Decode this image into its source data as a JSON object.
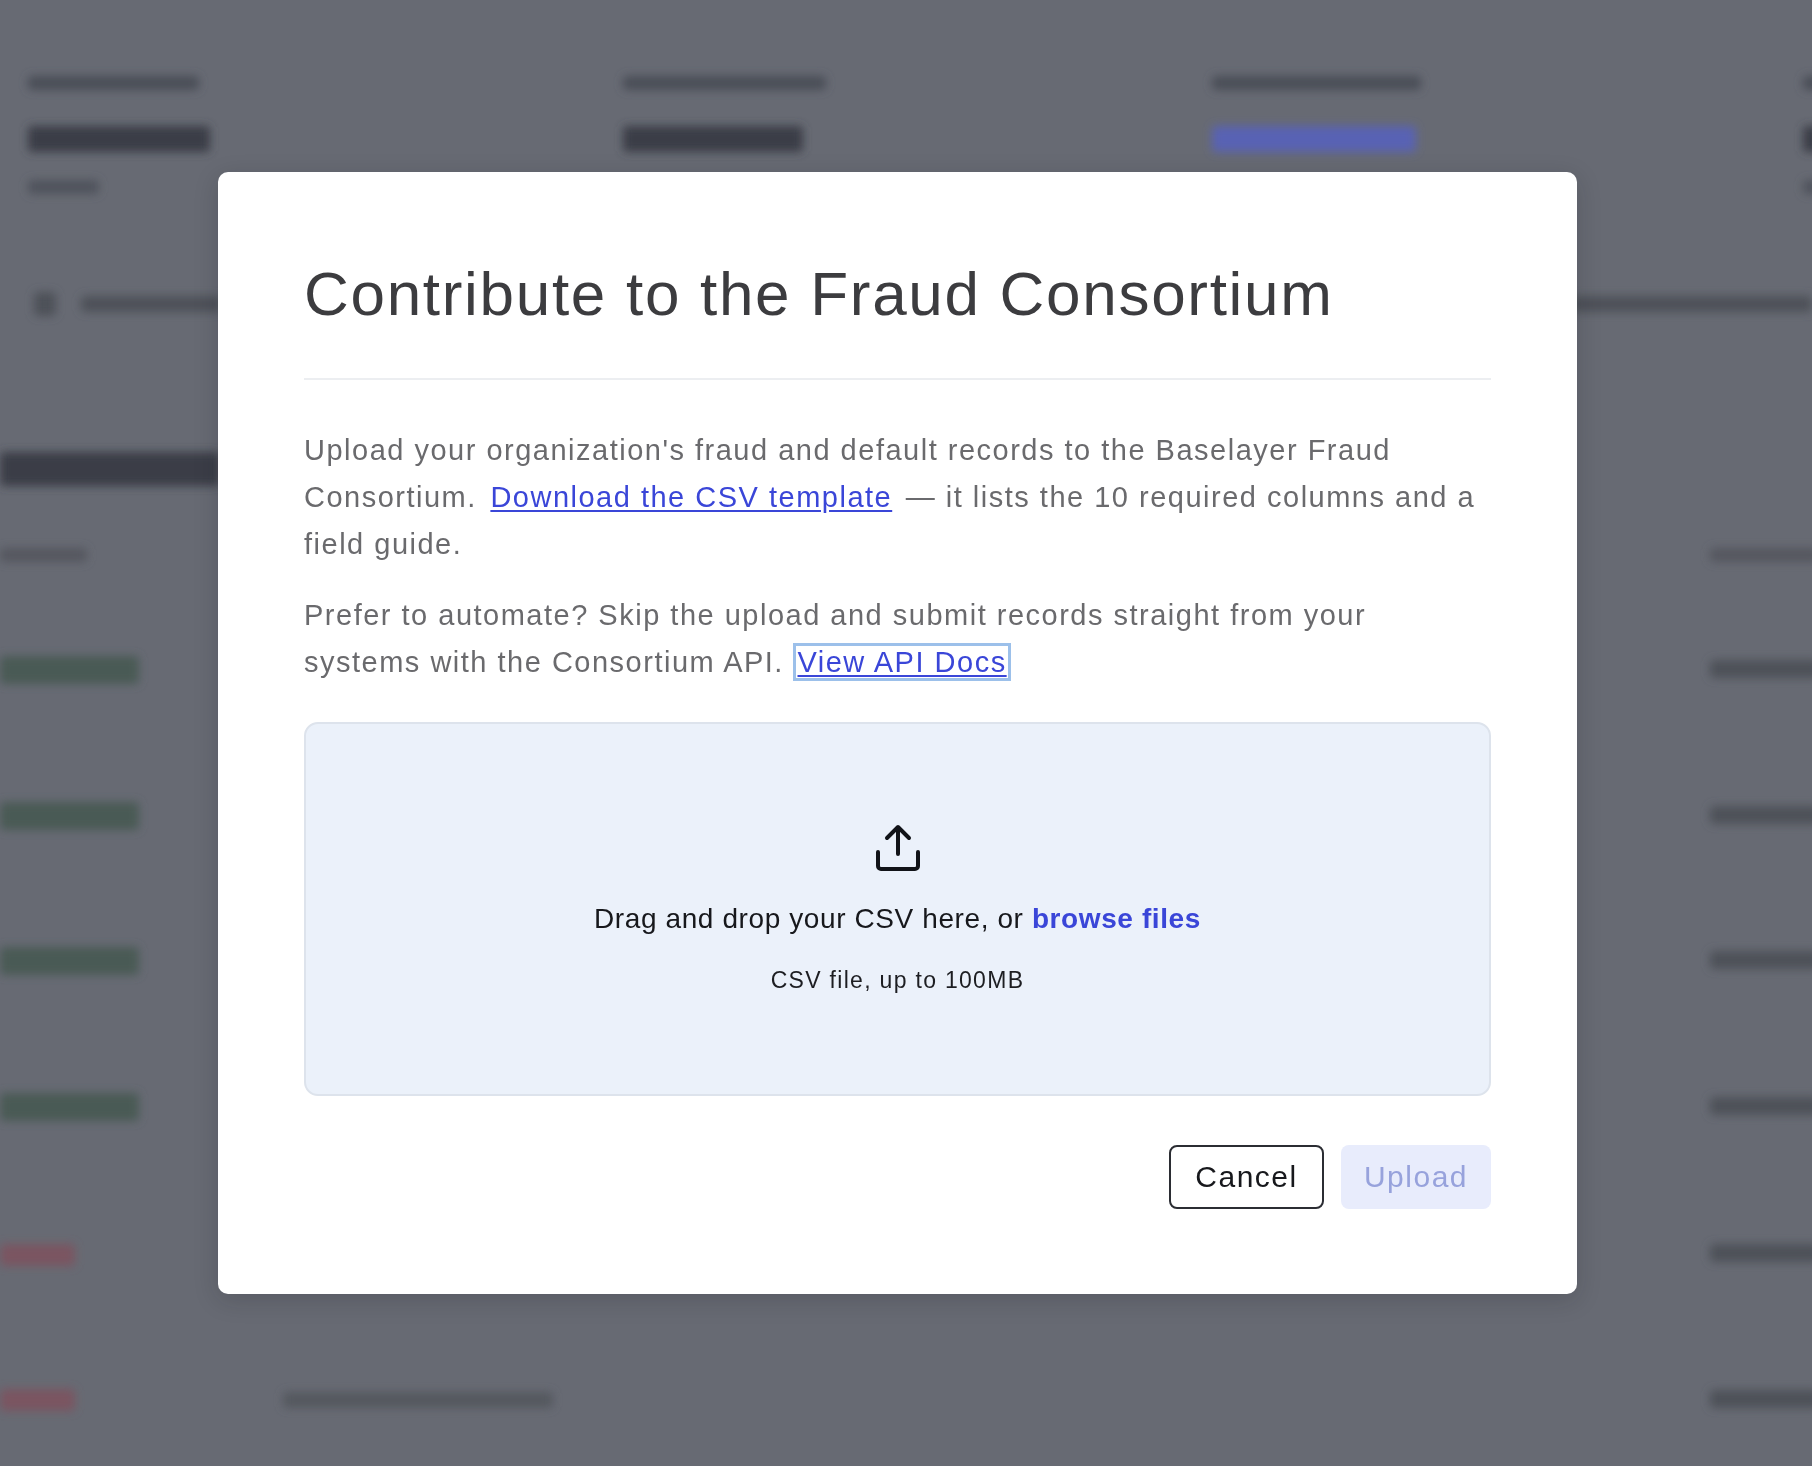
{
  "dialog": {
    "title": "Contribute to the Fraud Consortium",
    "paragraphs": [
      {
        "segments": [
          {
            "kind": "text",
            "text": "Upload your organization's fraud and default records to the Baselayer Fraud Consortium. "
          },
          {
            "kind": "link",
            "text": "Download the CSV template",
            "focused": false
          },
          {
            "kind": "text",
            "text": " — it lists the 10 required columns and a field guide."
          }
        ]
      },
      {
        "segments": [
          {
            "kind": "text",
            "text": "Prefer to automate? Skip the upload and submit records straight from your systems with the Consortium API. "
          },
          {
            "kind": "link",
            "text": "View API Docs",
            "focused": true
          }
        ]
      }
    ],
    "dropzone": {
      "instruction": "Drag and drop your CSV here, or ",
      "link": "browse files",
      "hint": "CSV file, up to 100MB"
    },
    "buttons": [
      {
        "label": "Cancel",
        "kind": "secondary",
        "disabled": false
      },
      {
        "label": "Upload",
        "kind": "primary",
        "disabled": true
      }
    ]
  }
}
